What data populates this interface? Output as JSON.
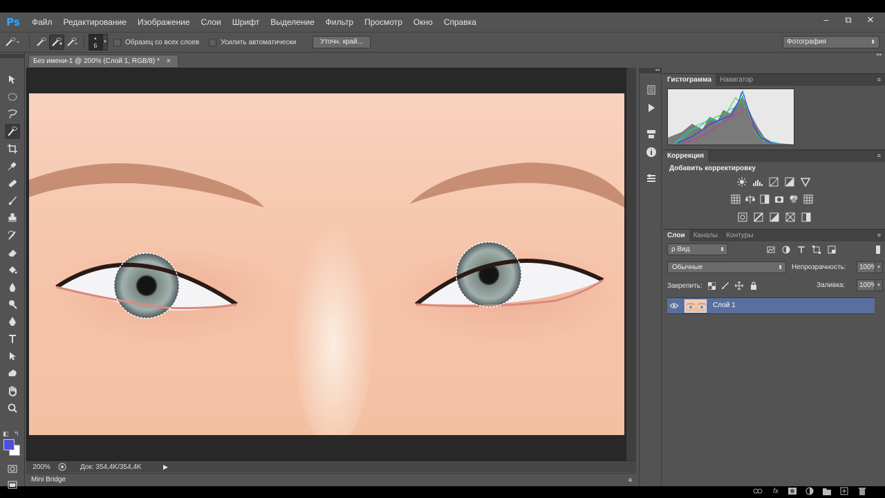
{
  "app": {
    "logo": "Ps",
    "menu": [
      "Файл",
      "Редактирование",
      "Изображение",
      "Слои",
      "Шрифт",
      "Выделение",
      "Фильтр",
      "Просмотр",
      "Окно",
      "Справка"
    ],
    "window_controls": {
      "minimize": "–",
      "restore": "⧉",
      "close": "✕"
    }
  },
  "options_bar": {
    "brush_size_top": "•",
    "brush_size": "6",
    "sample_all_layers": "Образец со всех слоев",
    "auto_enhance": "Усилить автоматически",
    "refine_edge": "Уточн. край...",
    "workspace": "Фотография"
  },
  "document": {
    "tab_title": "Без имени-1 @ 200% (Слой 1, RGB/8) *",
    "tab_close": "×",
    "zoom": "200%",
    "doc_size": "Док: 354,4K/354,4K",
    "status_arrow": "▶"
  },
  "minibridge": {
    "label": "Mini Bridge",
    "menu": "≡"
  },
  "panels": {
    "histogram_tabs": [
      {
        "label": "Гистограмма",
        "active": true
      },
      {
        "label": "Навигатор",
        "active": false
      }
    ],
    "adjustments_tab": "Коррекция",
    "adjustments_title": "Добавить корректировку",
    "layers_tabs": [
      {
        "label": "Слои",
        "active": true
      },
      {
        "label": "Каналы",
        "active": false
      },
      {
        "label": "Контуры",
        "active": false
      }
    ],
    "filter_kind": "ρ Вид",
    "blend_mode": "Обычные",
    "opacity_label": "Непрозрачность:",
    "opacity": "100%",
    "lock_label": "Закрепить:",
    "fill_label": "Заливка:",
    "fill": "100%",
    "layers": [
      {
        "name": "Слой 1",
        "visible": true,
        "selected": true
      }
    ],
    "panel_menu": "≡",
    "collapse_arrows": "◂◂",
    "expand_arrows": "▸▸"
  },
  "colors": {
    "foreground": "#4e4ee0",
    "background": "#ffffff",
    "selected_layer": "#5a6f9e",
    "logo": "#31a8ff"
  }
}
